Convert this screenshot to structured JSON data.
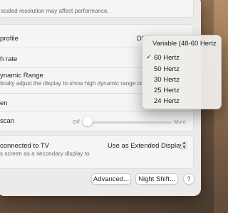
{
  "settings": {
    "top_note": "scaled resolution may affect performance.",
    "color_profile": {
      "label": "profile",
      "value": "DEL..."
    },
    "refresh_rate": {
      "label": "h rate"
    },
    "hdr": {
      "label": "ynamic Range",
      "description": "tically adjust the display to show high dynamic range conte"
    },
    "rotation_row": {
      "label": "en"
    },
    "underscan": {
      "label": "scan",
      "min_label": "Off",
      "max_label": "More",
      "level": 0.0
    },
    "tv": {
      "label": "connected to TV",
      "description": "s screen as a secondary display to",
      "value": "Use as Extended Display"
    },
    "buttons": {
      "advanced": "Advanced...",
      "night_shift": "Night Shift...",
      "help": "?"
    }
  },
  "refresh_menu": {
    "items": [
      {
        "label": "Variable (48-60 Hertz",
        "checked": false
      },
      {
        "label": "60 Hertz",
        "checked": true
      },
      {
        "label": "50 Hertz",
        "checked": false
      },
      {
        "label": "30 Hertz",
        "checked": false
      },
      {
        "label": "25 Hertz",
        "checked": false
      },
      {
        "label": "24 Hertz",
        "checked": false
      }
    ],
    "check_glyph": "✓"
  }
}
